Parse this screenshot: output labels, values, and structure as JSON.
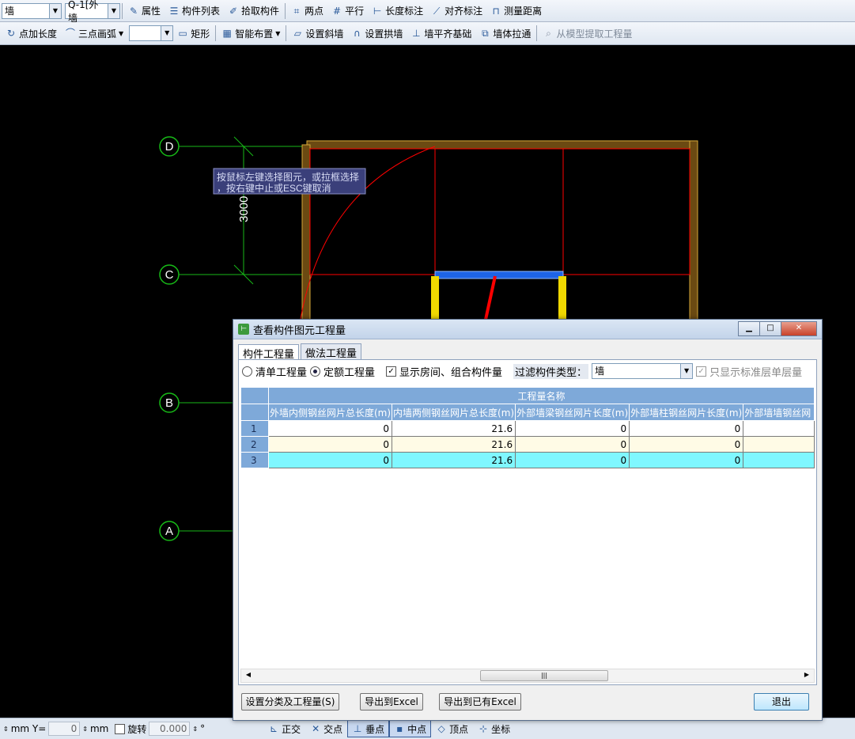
{
  "toolbar1": {
    "type_value": "墙",
    "component_value": "Q-1[外墙",
    "items": [
      {
        "icon": "properties-icon",
        "label": "属性"
      },
      {
        "icon": "component-list-icon",
        "label": "构件列表"
      },
      {
        "icon": "pick-component-icon",
        "label": "拾取构件"
      },
      {
        "icon": "two-point-icon",
        "label": "两点"
      },
      {
        "icon": "parallel-icon",
        "label": "平行"
      },
      {
        "icon": "length-dimension-icon",
        "label": "长度标注"
      },
      {
        "icon": "aligned-dimension-icon",
        "label": "对齐标注"
      },
      {
        "icon": "measure-distance-icon",
        "label": "测量距离"
      }
    ]
  },
  "toolbar2": {
    "point_length_label": "点加长度",
    "arc_label": "三点画弧",
    "items": [
      {
        "icon": "rectangle-icon",
        "label": "矩形"
      },
      {
        "icon": "smart-layout-icon",
        "label": "智能布置"
      },
      {
        "icon": "slope-wall-icon",
        "label": "设置斜墙"
      },
      {
        "icon": "arch-wall-icon",
        "label": "设置拱墙"
      },
      {
        "icon": "align-foundation-icon",
        "label": "墙平齐基础"
      },
      {
        "icon": "wall-pull-through-icon",
        "label": "墙体拉通"
      }
    ],
    "extract_label": "从模型提取工程量"
  },
  "canvas": {
    "axis_labels": [
      "D",
      "C",
      "B",
      "A"
    ],
    "dimension_text": "3000",
    "tooltip_line1": "按鼠标左键选择图元，或拉框选择",
    "tooltip_line2": "，按右键中止或ESC键取消",
    "colors": {
      "wall": "#6b4a12",
      "beam": "#1e64e6",
      "column": "#f0d800",
      "grid_line": "#17b917",
      "red_line": "#ff0000"
    }
  },
  "status": {
    "mm_label": "mm Y=",
    "y_value": "0",
    "mm_label2": "mm",
    "rotate_label": "旋转",
    "rotate_value": "0.000",
    "degree": "°",
    "snaps": [
      {
        "icon": "ortho-icon",
        "label": "正交"
      },
      {
        "icon": "intersection-icon",
        "label": "交点"
      },
      {
        "icon": "perpendicular-icon",
        "label": "垂点"
      },
      {
        "icon": "midpoint-icon",
        "label": "中点"
      },
      {
        "icon": "vertex-icon",
        "label": "顶点"
      },
      {
        "icon": "coordinate-icon",
        "label": "坐标"
      }
    ]
  },
  "dialog": {
    "title": "查看构件图元工程量",
    "tabs": [
      "构件工程量",
      "做法工程量"
    ],
    "radio_bill": "清单工程量",
    "radio_quota": "定额工程量",
    "show_rooms_label": "显示房间、组合构件量",
    "filter_type_label": "过滤构件类型：",
    "filter_type_value": "墙",
    "only_standard_label": "只显示标准层单层量",
    "group_header": "工程量名称",
    "columns": [
      "外墙内侧钢丝网片总长度(m)",
      "内墙两侧钢丝网片总长度(m)",
      "外部墙梁钢丝网片长度(m)",
      "外部墙柱钢丝网片长度(m)",
      "外部墙墙钢丝网"
    ],
    "rows": [
      {
        "num": "1",
        "values": [
          "0",
          "21.6",
          "0",
          "0",
          ""
        ]
      },
      {
        "num": "2",
        "values": [
          "0",
          "21.6",
          "0",
          "0",
          ""
        ]
      },
      {
        "num": "3",
        "values": [
          "0",
          "21.6",
          "0",
          "0",
          ""
        ]
      }
    ],
    "buttons": {
      "set_category": "设置分类及工程量(S)",
      "export_excel": "导出到Excel",
      "export_existing": "导出到已有Excel",
      "exit": "退出"
    }
  }
}
